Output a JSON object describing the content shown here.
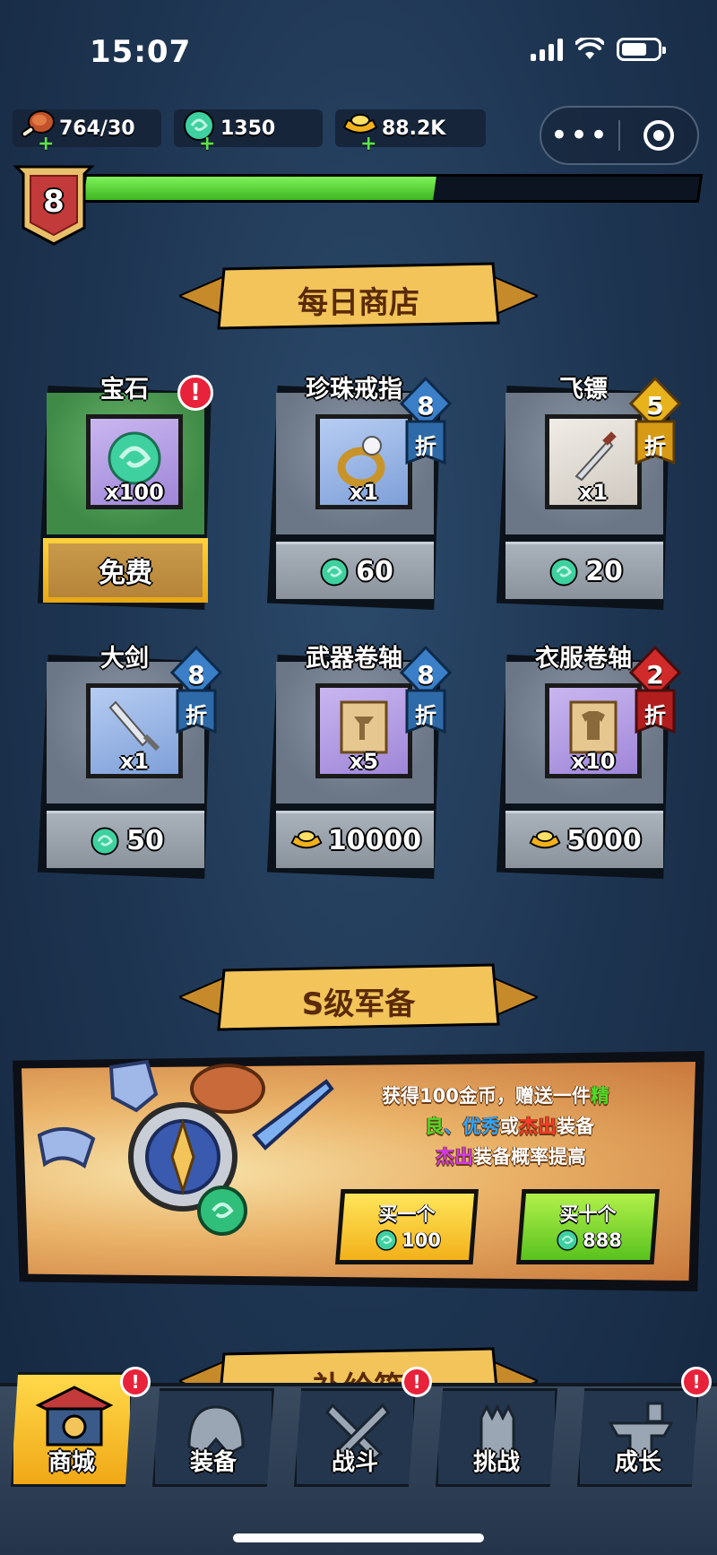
{
  "status": {
    "time": "15:07"
  },
  "resources": {
    "stamina": "764/30",
    "gems": "1350",
    "gold": "88.2K"
  },
  "player": {
    "level": "8",
    "xp_fraction": 0.57
  },
  "daily_shop": {
    "title": "每日商店",
    "items": [
      {
        "name": "宝石",
        "qty": "x100",
        "price": "免费",
        "currency": "free",
        "discount": "",
        "alert": "!"
      },
      {
        "name": "珍珠戒指",
        "qty": "x1",
        "price": "60",
        "currency": "gem",
        "discount": "8",
        "discount_label": "折"
      },
      {
        "name": "飞镖",
        "qty": "x1",
        "price": "20",
        "currency": "gem",
        "discount": "5",
        "discount_label": "折"
      },
      {
        "name": "大剑",
        "qty": "x1",
        "price": "50",
        "currency": "gem",
        "discount": "8",
        "discount_label": "折"
      },
      {
        "name": "武器卷轴",
        "qty": "x5",
        "price": "10000",
        "currency": "gold",
        "discount": "8",
        "discount_label": "折"
      },
      {
        "name": "衣服卷轴",
        "qty": "x10",
        "price": "5000",
        "currency": "gold",
        "discount": "2",
        "discount_label": "折"
      }
    ]
  },
  "s_gear": {
    "title": "S级军备",
    "desc_line1a": "获得100金币，赠送一件",
    "desc_line1b": "精",
    "desc_line2a": "良",
    "desc_line2b": "、",
    "desc_line2c": "优秀",
    "desc_line2d": "或",
    "desc_line2e": "杰出",
    "desc_line2f": "装备",
    "desc_line3a": "杰出",
    "desc_line3b": "装备概率提高",
    "buy_one_label": "买一个",
    "buy_one_price": "100",
    "buy_ten_label": "买十个",
    "buy_ten_price": "888"
  },
  "next_section": {
    "title": "补给箱"
  },
  "nav": {
    "tabs": [
      {
        "label": "商城",
        "active": true,
        "alert": true
      },
      {
        "label": "装备",
        "active": false,
        "alert": false
      },
      {
        "label": "战斗",
        "active": false,
        "alert": true
      },
      {
        "label": "挑战",
        "active": false,
        "alert": false
      },
      {
        "label": "成长",
        "active": false,
        "alert": true
      }
    ],
    "alert_mark": "!"
  },
  "colors": {
    "xp_fill": "#5fd63a",
    "gem": "#3fd0a0",
    "gold": "#f2b11a",
    "green_text": "#4ddc2a",
    "blue_text": "#2fa6ff",
    "red_text": "#ff3a2a",
    "purple_text": "#d43ae8",
    "discount_blue": "#3a7fc8",
    "discount_gold": "#e8b21c",
    "discount_red": "#d12a2a"
  }
}
